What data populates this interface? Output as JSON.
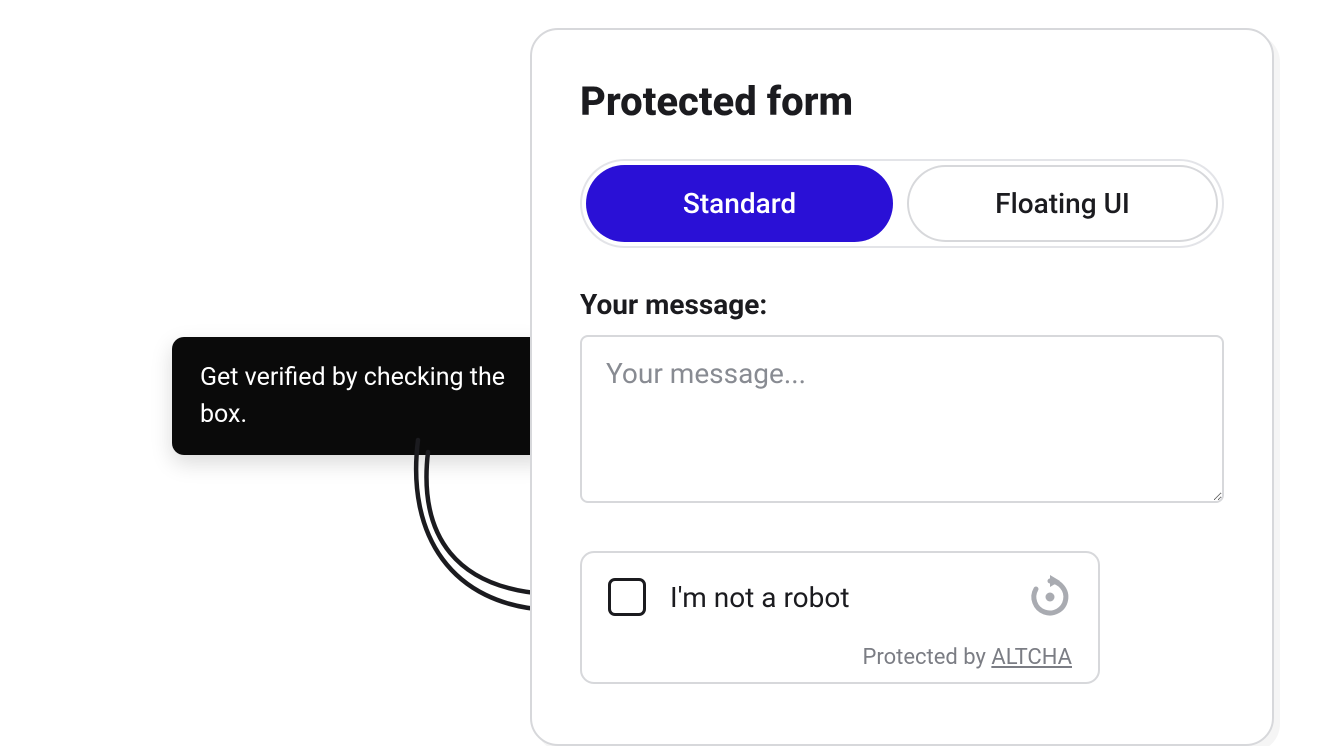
{
  "tooltip": {
    "text": "Get verified by checking the box."
  },
  "form": {
    "title": "Protected form",
    "tabs": {
      "standard": "Standard",
      "floating": "Floating UI"
    },
    "message": {
      "label": "Your message:",
      "placeholder": "Your message..."
    },
    "captcha": {
      "label": "I'm not a robot",
      "protected_by_prefix": "Protected by ",
      "brand": "ALTCHA"
    }
  }
}
